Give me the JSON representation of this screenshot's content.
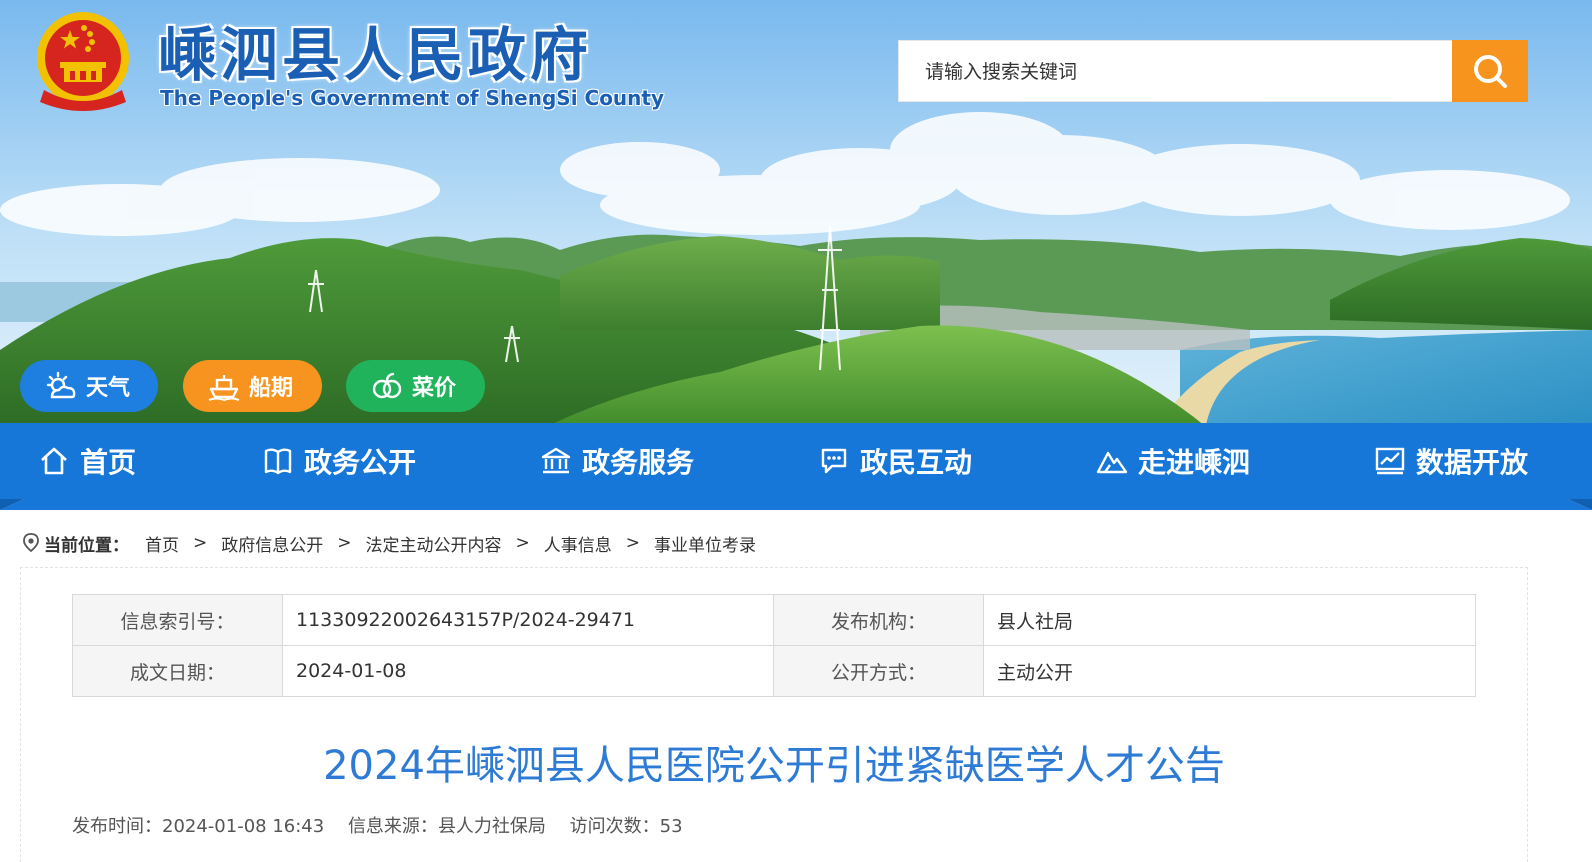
{
  "header": {
    "title_cn": "嵊泗县人民政府",
    "title_en": "The People's Government of ShengSi County",
    "emblem_icon": "national-emblem-icon"
  },
  "search": {
    "placeholder": "请输入搜索关键词",
    "button_icon": "search-icon",
    "button_color": "#f7941d"
  },
  "quick_links": [
    {
      "label": "天气",
      "icon": "weather-icon",
      "color": "#1e7fe0"
    },
    {
      "label": "船期",
      "icon": "ship-icon",
      "color": "#f7931f"
    },
    {
      "label": "菜价",
      "icon": "vegetable-icon",
      "color": "#21b35b"
    }
  ],
  "nav": {
    "color": "#1677d9",
    "items": [
      {
        "label": "首页",
        "icon": "home-icon"
      },
      {
        "label": "政务公开",
        "icon": "book-icon"
      },
      {
        "label": "政务服务",
        "icon": "bank-icon"
      },
      {
        "label": "政民互动",
        "icon": "chat-icon"
      },
      {
        "label": "走进嵊泗",
        "icon": "mountain-icon"
      },
      {
        "label": "数据开放",
        "icon": "chart-icon"
      }
    ]
  },
  "breadcrumb": {
    "label": "当前位置：",
    "items": [
      "首页",
      "政府信息公开",
      "法定主动公开内容",
      "人事信息",
      "事业单位考录"
    ],
    "separator": ">"
  },
  "meta": {
    "index_label": "信息索引号：",
    "index_value": "11330922002643157P/2024-29471",
    "org_label": "发布机构：",
    "org_value": "县人社局",
    "date_label": "成文日期：",
    "date_value": "2024-01-08",
    "mode_label": "公开方式：",
    "mode_value": "主动公开"
  },
  "article": {
    "title": "2024年嵊泗县人民医院公开引进紧缺医学人才公告",
    "title_color": "#2e7bd6",
    "publish_time_label": "发布时间：",
    "publish_time": "2024-01-08 16:43",
    "source_label": "信息来源：",
    "source": "县人力社保局",
    "visits_label": "访问次数：",
    "visits": "53"
  }
}
